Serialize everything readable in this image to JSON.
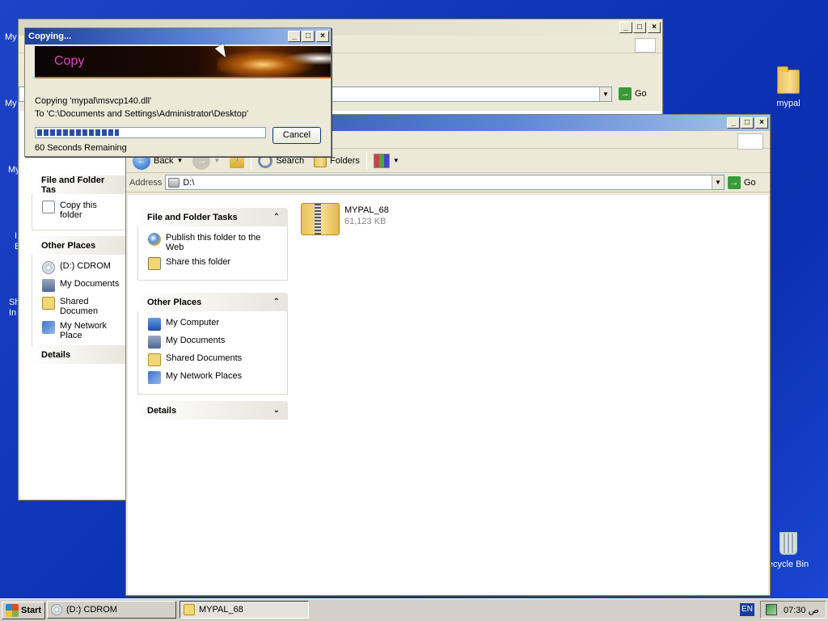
{
  "desktop": {
    "icons": [
      {
        "label": "mypal"
      },
      {
        "label": "ecycle Bin"
      }
    ],
    "clipped_labels": [
      "My",
      "My",
      "My",
      "I",
      "E",
      "Sh",
      "In"
    ]
  },
  "back_window": {
    "address_go": "Go",
    "tasks_title": "File and Folder Tas",
    "tasks": [
      "Copy this folder"
    ],
    "places_title": "Other Places",
    "places": [
      "(D:) CDROM",
      "My Documents",
      "Shared Documen",
      "My Network Place"
    ],
    "details_title": "Details"
  },
  "main_window": {
    "toolbar": {
      "back": "Back",
      "search": "Search",
      "folders": "Folders"
    },
    "address_label": "Address",
    "address_value": "D:\\",
    "go": "Go",
    "tasks_panel": {
      "title": "File and Folder Tasks",
      "items": [
        "Publish this folder to the Web",
        "Share this folder"
      ]
    },
    "places_panel": {
      "title": "Other Places",
      "items": [
        "My Computer",
        "My Documents",
        "Shared Documents",
        "My Network Places"
      ]
    },
    "details_panel": {
      "title": "Details"
    },
    "file": {
      "name": "MYPAL_68",
      "size": "61,123 KB"
    }
  },
  "copy_dialog": {
    "title": "Copying...",
    "banner_text": "Copy",
    "line1": "Copying 'mypal\\msvcp140.dll'",
    "line2": "To 'C:\\Documents and Settings\\Administrator\\Desktop'",
    "remaining": "60 Seconds Remaining",
    "cancel": "Cancel",
    "progress_fraction": 0.36
  },
  "taskbar": {
    "start": "Start",
    "tasks": [
      "(D:) CDROM",
      "MYPAL_68"
    ],
    "lang": "EN",
    "clock": "07:30 ص"
  }
}
